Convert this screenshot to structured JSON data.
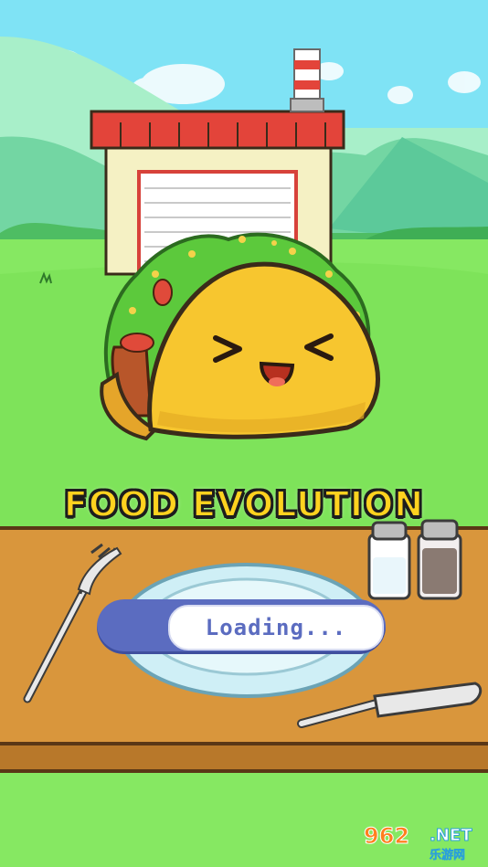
{
  "game": {
    "title": "FOOD EVOLUTION",
    "loading_label": "Loading...",
    "progress": 0.25
  },
  "watermark": {
    "number": "962",
    "suffix": ".NET",
    "subtitle": "乐游网"
  },
  "colors": {
    "sky": "#7fe3f5",
    "grass": "#7ee35a",
    "table": "#d9963c",
    "taco": "#f7c62f",
    "title_fill": "#ffd21f",
    "progress_bar": "#5b6cc0"
  }
}
